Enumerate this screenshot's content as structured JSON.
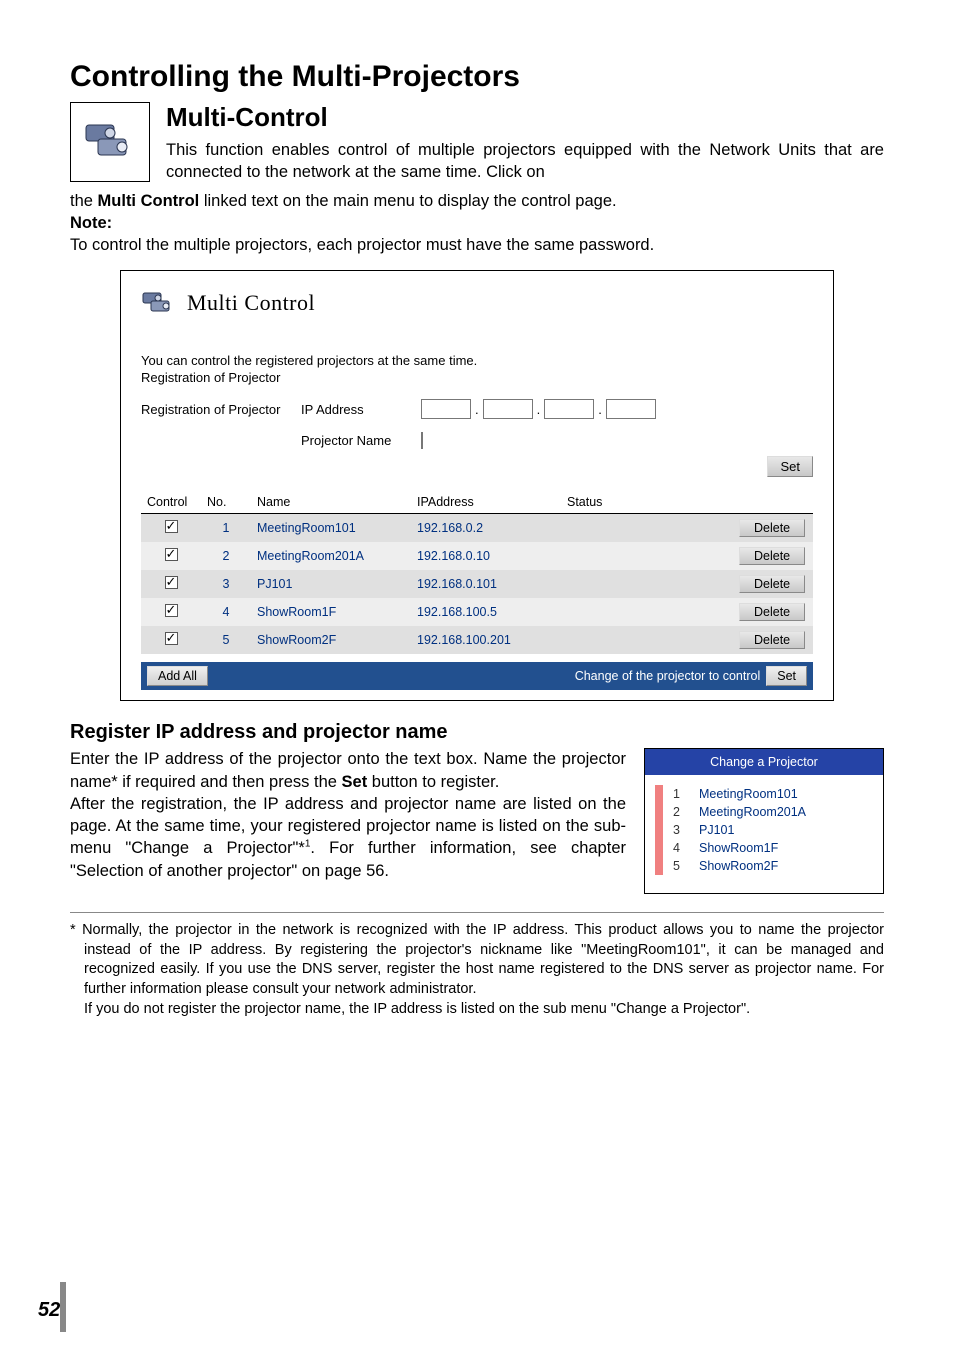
{
  "headings": {
    "h1": "Controlling the Multi-Projectors",
    "h2": "Multi-Control",
    "h3": "Register IP address and projector name"
  },
  "intro": {
    "para1a": "This function enables control of multiple projectors equipped with the Network Units that are connected to the network at the same time. Click on",
    "para1b_pre": "the ",
    "para1b_bold": "Multi Control",
    "para1b_post": " linked text on the main menu to display the control page.",
    "note_label": "Note:",
    "note_body": "To control the multiple projectors, each projector must have the same password."
  },
  "panel": {
    "title": "Multi Control",
    "line1": "You can control the registered projectors at the same time.",
    "line2": "Registration of Projector",
    "reg_label": "Registration of Projector",
    "ip_label": "IP Address",
    "name_label": "Projector Name",
    "set_btn": "Set",
    "table": {
      "headers": [
        "Control",
        "No.",
        "Name",
        "IPAddress",
        "Status",
        ""
      ],
      "rows": [
        {
          "no": "1",
          "name": "MeetingRoom101",
          "ip": "192.168.0.2",
          "del": "Delete"
        },
        {
          "no": "2",
          "name": "MeetingRoom201A",
          "ip": "192.168.0.10",
          "del": "Delete"
        },
        {
          "no": "3",
          "name": "PJ101",
          "ip": "192.168.0.101",
          "del": "Delete"
        },
        {
          "no": "4",
          "name": "ShowRoom1F",
          "ip": "192.168.100.5",
          "del": "Delete"
        },
        {
          "no": "5",
          "name": "ShowRoom2F",
          "ip": "192.168.100.201",
          "del": "Delete"
        }
      ]
    },
    "footer": {
      "add_all": "Add All",
      "change_label": "Change of the projector to control",
      "set_btn": "Set"
    }
  },
  "register_section": {
    "p1_a": "Enter the IP address of the projector onto the text box. Name the projector name* if required and then press the ",
    "p1_bold": "Set",
    "p1_b": " button to register.",
    "p2_a": "After the registration, the IP address and projector name are listed on the page. At the same time, your registered projector name is listed on the sub-menu \"Change a Projector\"*",
    "p2_sup": "1",
    "p2_b": ". For further information, see chapter \"Selection of another projector\" on page 56."
  },
  "submenu": {
    "header": "Change a Projector",
    "items": [
      {
        "idx": "1",
        "name": "MeetingRoom101"
      },
      {
        "idx": "2",
        "name": "MeetingRoom201A"
      },
      {
        "idx": "3",
        "name": "PJ101"
      },
      {
        "idx": "4",
        "name": "ShowRoom1F"
      },
      {
        "idx": "5",
        "name": "ShowRoom2F"
      }
    ]
  },
  "footnote": {
    "star1": "* Normally, the projector in the network is recognized with the IP address. This product allows you to name the projector instead of the IP address. By registering the projector's nickname like \"MeetingRoom101\", it can be managed and recognized easily. If you use the DNS server, register the host name registered to the DNS server as projector name. For further information please consult your network administrator.",
    "star2": "If you do not register the projector name, the IP address is listed on the sub menu \"Change a Projector\"."
  },
  "page_number": "52"
}
